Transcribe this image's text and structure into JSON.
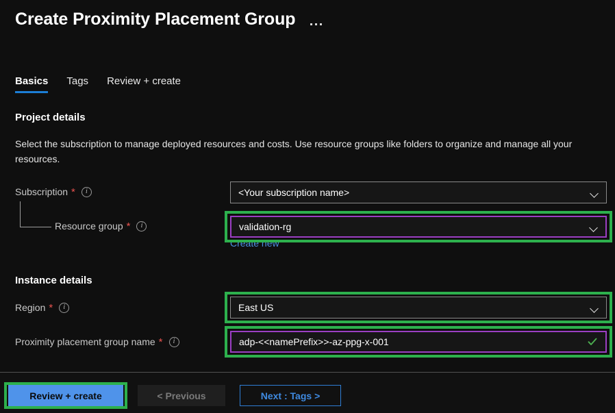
{
  "header": {
    "title": "Create Proximity Placement Group",
    "overflow_menu_icon": "ellipsis-icon"
  },
  "tabs": [
    {
      "label": "Basics",
      "active": true
    },
    {
      "label": "Tags",
      "active": false
    },
    {
      "label": "Review + create",
      "active": false
    }
  ],
  "project_details": {
    "heading": "Project details",
    "description": "Select the subscription to manage deployed resources and costs. Use resource groups like folders to organize and manage all your resources.",
    "subscription": {
      "label": "Subscription",
      "required_marker": "*",
      "info_icon": "info-icon",
      "value": "<Your subscription name>",
      "chevron_icon": "chevron-down-icon"
    },
    "resource_group": {
      "label": "Resource group",
      "required_marker": "*",
      "info_icon": "info-icon",
      "value": "validation-rg",
      "chevron_icon": "chevron-down-icon",
      "create_new_link": "Create new",
      "focused": true,
      "highlighted": true
    }
  },
  "instance_details": {
    "heading": "Instance details",
    "region": {
      "label": "Region",
      "required_marker": "*",
      "info_icon": "info-icon",
      "value": "East US",
      "chevron_icon": "chevron-down-icon",
      "highlighted": true
    },
    "ppg_name": {
      "label": "Proximity placement group name",
      "required_marker": "*",
      "info_icon": "info-icon",
      "value": "adp-<<namePrefix>>-az-ppg-x-001",
      "validation_icon": "checkmark-icon",
      "focused": true,
      "highlighted": true
    }
  },
  "footer": {
    "review_create_label": "Review + create",
    "previous_label": "< Previous",
    "next_label": "Next : Tags >",
    "review_create_highlighted": true,
    "previous_disabled": true
  },
  "colors": {
    "page_background": "#0f0f0f",
    "annotation_green": "#2db04d",
    "focus_purple": "#9b3fc4",
    "accent_blue": "#1c7ed6",
    "primary_button_blue": "#4f93ea",
    "link_blue": "#4c8fe0",
    "required_red": "#e8534f",
    "validation_green": "#4caf50",
    "input_border": "#8a8a8a",
    "label_gray": "#c9c9c9"
  }
}
